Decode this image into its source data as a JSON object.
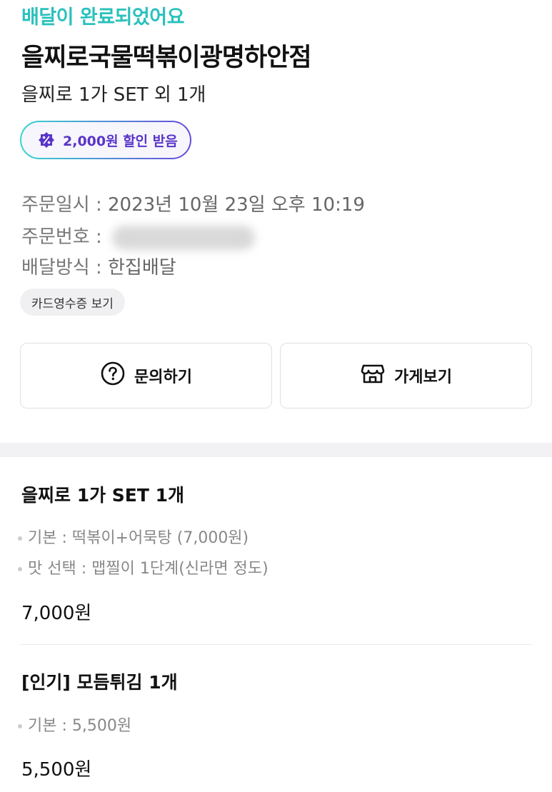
{
  "order": {
    "status": "배달이 완료되었어요",
    "store_name": "을찌로국물떡볶이광명하안점",
    "summary": "을찌로 1가 SET 외 1개",
    "coupon_label": "2,000원 할인 받음",
    "date_label": "주문일시 : ",
    "date_value": "2023년 10월 23일 오후 10:19",
    "number_label": "주문번호 : ",
    "method_label": "배달방식 : ",
    "method_value": "한집배달",
    "receipt_label": "카드영수증 보기"
  },
  "actions": {
    "inquiry_label": "문의하기",
    "store_label": "가게보기"
  },
  "items": [
    {
      "title": "을찌로 1가 SET 1개",
      "options": [
        "기본 : 떡볶이+어묵탕 (7,000원)",
        "맛 선택 : 맵찔이 1단계(신라면 정도)"
      ],
      "price": "7,000원"
    },
    {
      "title": "[인기] 모듬튀김 1개",
      "options": [
        "기본 : 5,500원"
      ],
      "price": "5,500원"
    }
  ],
  "colors": {
    "accent": "#2ac1bc",
    "coupon_text": "#5a35c9",
    "coupon_gradient_start": "#38d6d0",
    "coupon_gradient_end": "#6a4bdb"
  },
  "icons": {
    "coupon": "discount-badge-icon",
    "inquiry": "question-circle-icon",
    "store": "storefront-icon"
  }
}
